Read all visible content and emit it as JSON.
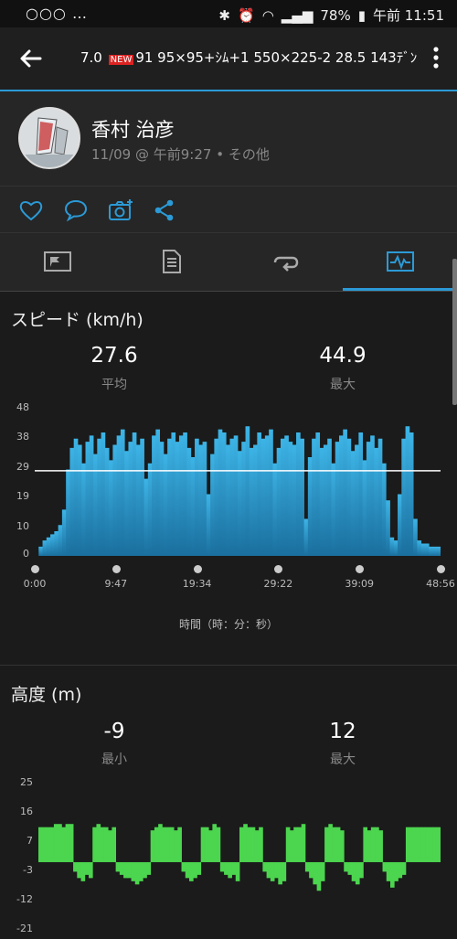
{
  "status": {
    "left_dots": "○○○ …",
    "battery": "78%",
    "time": "午前 11:51"
  },
  "appbar": {
    "title_pre": "7.0",
    "title_badge": "NEW",
    "title_post": "91 95×95+ｼﾑ+1 550×225-2  28.5  143ﾃﾞﾝ"
  },
  "profile": {
    "name": "香村 治彦",
    "subtitle": "11/09 @ 午前9:27 • その他"
  },
  "colors": {
    "accent": "#2b9ad6",
    "speed": "#2a9fd2",
    "elevation": "#4cd54f"
  },
  "speed": {
    "title": "スピード (km/h)",
    "avg_value": "27.6",
    "avg_label": "平均",
    "max_value": "44.9",
    "max_label": "最大",
    "x_axis_label": "時間（時：分：秒）"
  },
  "elevation": {
    "title": "高度 (m)",
    "min_value": "-9",
    "min_label": "最小",
    "max_value": "12",
    "max_label": "最大"
  },
  "chart_data": [
    {
      "type": "area",
      "title": "スピード (km/h)",
      "xlabel": "時間（時：分：秒）",
      "ylim": [
        0,
        48
      ],
      "y_ticks": [
        "48",
        "38",
        "29",
        "19",
        "10",
        "0"
      ],
      "x_ticks": [
        "0:00",
        "9:47",
        "19:34",
        "29:22",
        "39:09",
        "48:56"
      ],
      "average_line": 27.6,
      "series": [
        {
          "values": [
            0,
            3,
            5,
            6,
            7,
            8,
            10,
            15,
            28,
            35,
            38,
            36,
            30,
            37,
            39,
            33,
            38,
            40,
            35,
            31,
            36,
            39,
            41,
            34,
            37,
            40,
            36,
            38,
            25,
            30,
            39,
            41,
            37,
            33,
            38,
            40,
            37,
            39,
            40,
            35,
            32,
            38,
            36,
            37,
            20,
            33,
            38,
            41,
            40,
            36,
            38,
            39,
            34,
            37,
            42,
            35,
            36,
            40,
            38,
            39,
            41,
            30,
            35,
            38,
            39,
            37,
            36,
            40,
            38,
            12,
            32,
            38,
            40,
            35,
            36,
            38,
            30,
            37,
            39,
            41,
            38,
            34,
            36,
            40,
            31,
            37,
            39,
            35,
            38,
            30,
            18,
            6,
            5,
            20,
            38,
            42,
            40,
            12,
            5,
            4,
            4,
            3,
            3,
            3
          ]
        }
      ]
    },
    {
      "type": "area",
      "title": "高度 (m)",
      "ylim": [
        -21,
        25
      ],
      "y_ticks": [
        "25",
        "16",
        "7",
        "-3",
        "-12",
        "-21"
      ],
      "series": [
        {
          "values": [
            11,
            11,
            11,
            11,
            12,
            12,
            11,
            12,
            12,
            -3,
            -5,
            -6,
            -4,
            -5,
            11,
            12,
            11,
            11,
            10,
            11,
            -3,
            -4,
            -5,
            -5,
            -6,
            -7,
            -6,
            -5,
            -4,
            10,
            11,
            12,
            11,
            11,
            11,
            10,
            11,
            -3,
            -5,
            -6,
            -5,
            -4,
            11,
            11,
            10,
            12,
            11,
            -3,
            -4,
            -5,
            -4,
            -6,
            11,
            12,
            11,
            11,
            10,
            11,
            -3,
            -5,
            -6,
            -5,
            -7,
            -6,
            11,
            10,
            11,
            11,
            12,
            -3,
            -5,
            -7,
            -9,
            -6,
            11,
            12,
            11,
            11,
            10,
            -3,
            -4,
            -6,
            -7,
            -5,
            11,
            10,
            11,
            11,
            10,
            -3,
            -6,
            -8,
            -6,
            -5,
            -4,
            11,
            11,
            11,
            11,
            11,
            11,
            11,
            11,
            11
          ]
        }
      ]
    }
  ]
}
